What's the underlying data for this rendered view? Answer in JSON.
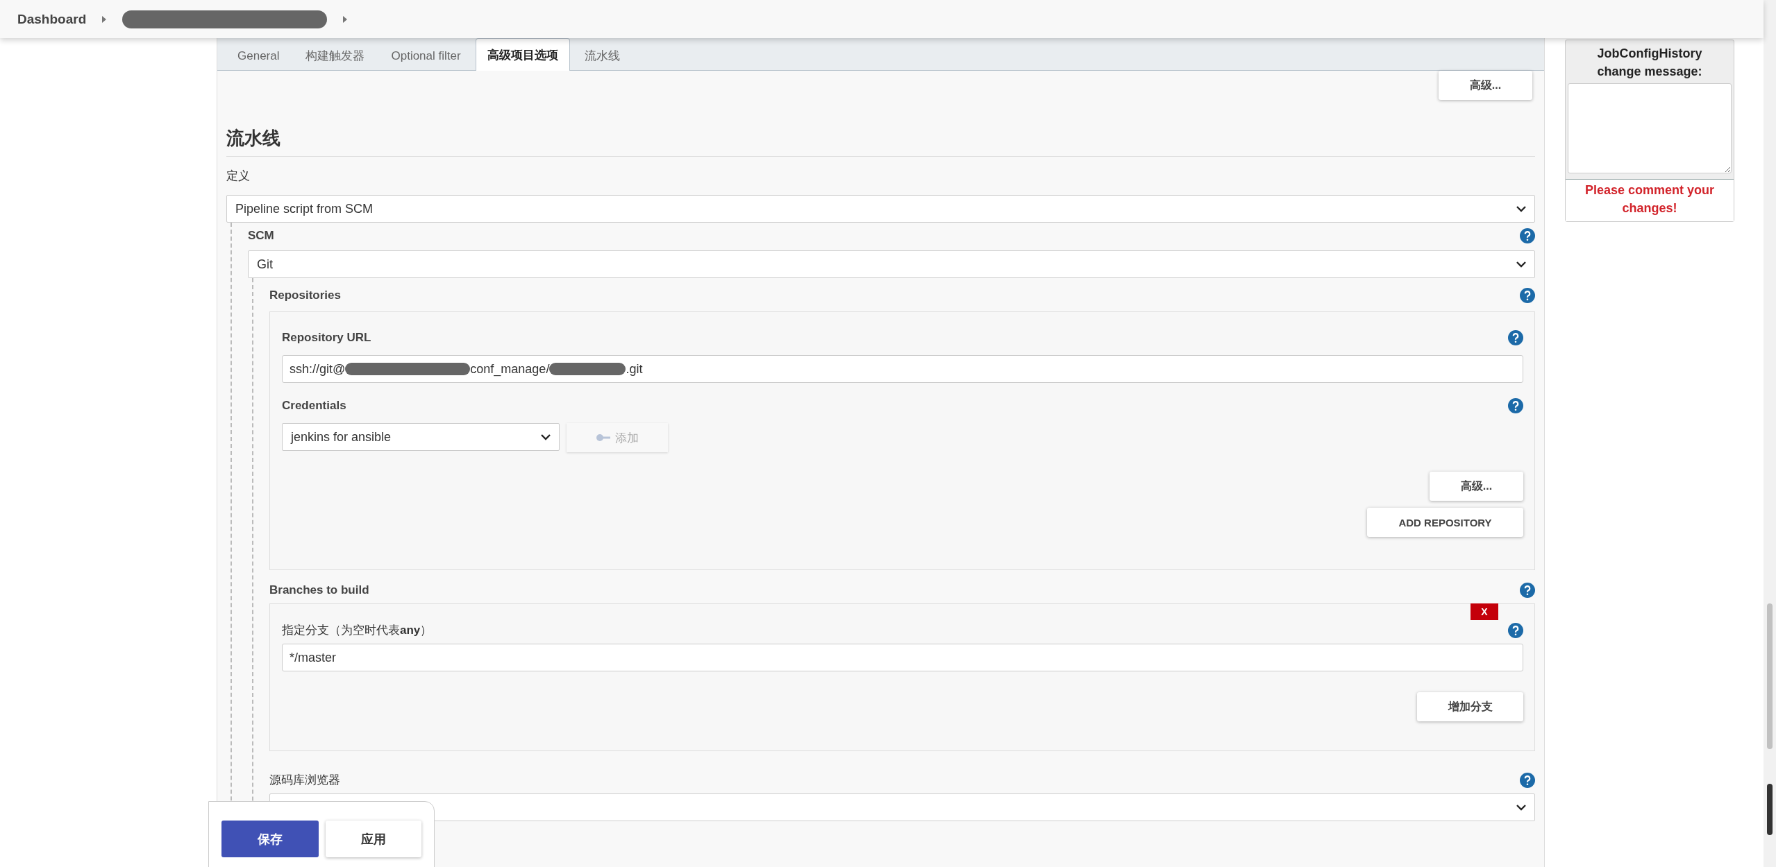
{
  "breadcrumb": [
    {
      "kind": "text",
      "label": "Dashboard"
    },
    {
      "kind": "redacted"
    }
  ],
  "tabs": [
    {
      "label": "General",
      "selected": false
    },
    {
      "label": "构建触发器",
      "selected": false
    },
    {
      "label": "Optional filter",
      "selected": false
    },
    {
      "label": "高级项目选项",
      "selected": true
    },
    {
      "label": "流水线",
      "selected": false
    }
  ],
  "top_button": "高级...",
  "section_title": "流水线",
  "definition": {
    "label": "定义",
    "value": "Pipeline script from SCM"
  },
  "scm": {
    "label": "SCM",
    "value": "Git"
  },
  "repositories": {
    "label": "Repositories",
    "url_label": "Repository URL",
    "url_segments": [
      {
        "kind": "text",
        "text": "ssh://git@"
      },
      {
        "kind": "redacted"
      },
      {
        "kind": "text",
        "text": "conf_manage/"
      },
      {
        "kind": "redacted"
      },
      {
        "kind": "text",
        "text": ".git"
      }
    ],
    "credentials_label": "Credentials",
    "credentials_value": "jenkins for ansible",
    "add_button": {
      "label": "添加",
      "disabled": true
    },
    "advanced_button": "高级...",
    "add_repository_button": "ADD REPOSITORY"
  },
  "branches": {
    "label": "Branches to build",
    "delete_button": "X",
    "branch_label": "指定分支（为空时代表**any**）",
    "branch_value": "*/master",
    "add_branch_button": "增加分支"
  },
  "browser": {
    "label": "源码库浏览器"
  },
  "sidebar": {
    "title": "JobConfigHistory change message:",
    "warning": "Please comment your changes!"
  },
  "actions": {
    "save": "保存",
    "apply": "应用"
  }
}
